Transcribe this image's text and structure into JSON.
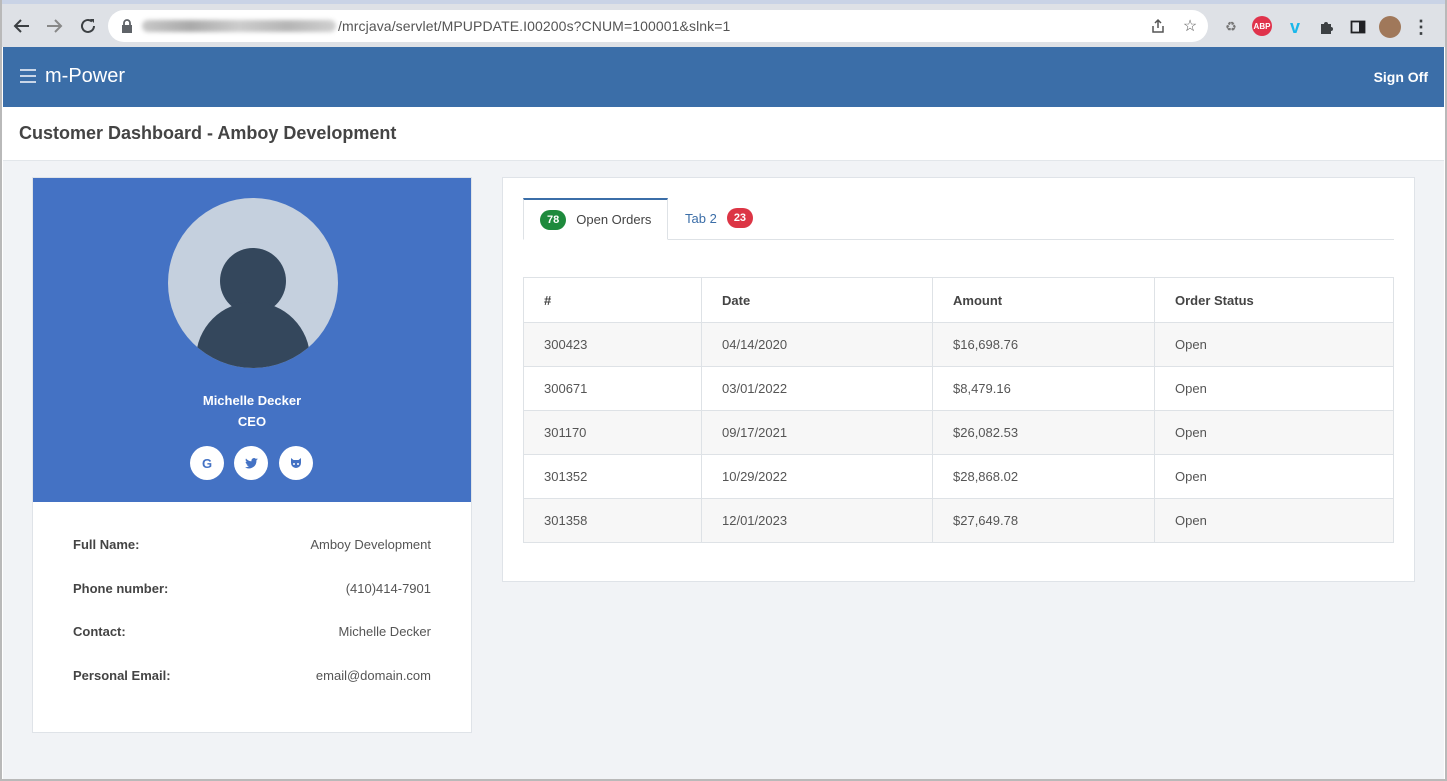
{
  "browser": {
    "url": "/mrcjava/servlet/MPUPDATE.I00200s?CNUM=100001&slnk=1",
    "extensions": [
      "recycle-icon",
      "adblock-icon",
      "vimeo-icon",
      "puzzle-icon",
      "sidepanel-icon",
      "profile-avatar-icon"
    ],
    "adblock_label": "ABP"
  },
  "app": {
    "brand": "m-Power",
    "sign_off": "Sign Off"
  },
  "page": {
    "title": "Customer Dashboard - Amboy Development"
  },
  "profile": {
    "name": "Michelle Decker",
    "role": "CEO",
    "social": [
      {
        "icon": "google-icon",
        "glyph": "G"
      },
      {
        "icon": "twitter-icon",
        "glyph": "🐦"
      },
      {
        "icon": "github-icon",
        "glyph": "🐱"
      }
    ],
    "details": [
      {
        "label": "Full Name:",
        "value": "Amboy Development"
      },
      {
        "label": "Phone number:",
        "value": "(410)414-7901"
      },
      {
        "label": "Contact:",
        "value": "Michelle Decker"
      },
      {
        "label": "Personal Email:",
        "value": "email@domain.com"
      }
    ]
  },
  "orders": {
    "tabs": [
      {
        "label": "Open Orders",
        "badge": "78",
        "badge_color": "#1e8a3c"
      },
      {
        "label": "Tab 2",
        "badge": "23",
        "badge_color": "#dc3545"
      }
    ],
    "columns": [
      "#",
      "Date",
      "Amount",
      "Order Status"
    ],
    "rows": [
      [
        "300423",
        "04/14/2020",
        "$16,698.76",
        "Open"
      ],
      [
        "300671",
        "03/01/2022",
        "$8,479.16",
        "Open"
      ],
      [
        "301170",
        "09/17/2021",
        "$26,082.53",
        "Open"
      ],
      [
        "301352",
        "10/29/2022",
        "$28,868.02",
        "Open"
      ],
      [
        "301358",
        "12/01/2023",
        "$27,649.78",
        "Open"
      ]
    ]
  },
  "colors": {
    "header": "#3b6ea8",
    "profile_bg": "#4472c4",
    "badge_green": "#1e8a3c",
    "badge_red": "#dc3545"
  }
}
